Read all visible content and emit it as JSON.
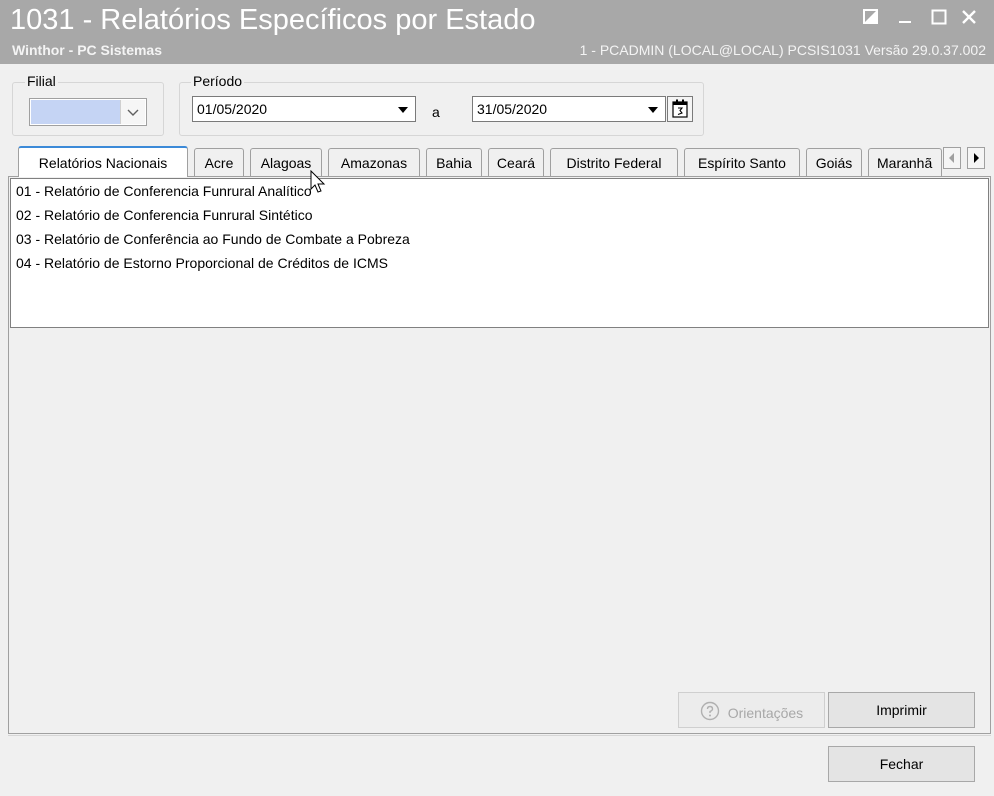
{
  "window": {
    "title": "1031 - Relatórios Específicos por Estado",
    "subtitle_left": "Winthor - PC Sistemas",
    "subtitle_right": "1 - PCADMIN (LOCAL@LOCAL)   PCSIS1031  Versão  29.0.37.002"
  },
  "filial": {
    "label": "Filial",
    "value": ""
  },
  "periodo": {
    "label": "Período",
    "start": "01/05/2020",
    "separator": "a",
    "end": "31/05/2020"
  },
  "tabs": [
    {
      "label": "Relatórios Nacionais"
    },
    {
      "label": "Acre"
    },
    {
      "label": "Alagoas"
    },
    {
      "label": "Amazonas"
    },
    {
      "label": "Bahia"
    },
    {
      "label": "Ceará"
    },
    {
      "label": "Distrito Federal"
    },
    {
      "label": "Espírito Santo"
    },
    {
      "label": "Goiás"
    },
    {
      "label": "Maranhã"
    }
  ],
  "reports": [
    {
      "label": "01 - Relatório de Conferencia Funrural Analítico"
    },
    {
      "label": "02 - Relatório de Conferencia Funrural Sintético"
    },
    {
      "label": "03 - Relatório de Conferência ao Fundo de Combate a Pobreza"
    },
    {
      "label": "04 - Relatório de Estorno Proporcional de Créditos de ICMS"
    }
  ],
  "buttons": {
    "orientacoes": "Orientações",
    "imprimir": "Imprimir",
    "fechar": "Fechar"
  },
  "colors": {
    "titlebar": "#a8a8a8",
    "filial_selection": "#c5d4f4",
    "active_tab_accent": "#3c8ad8"
  }
}
